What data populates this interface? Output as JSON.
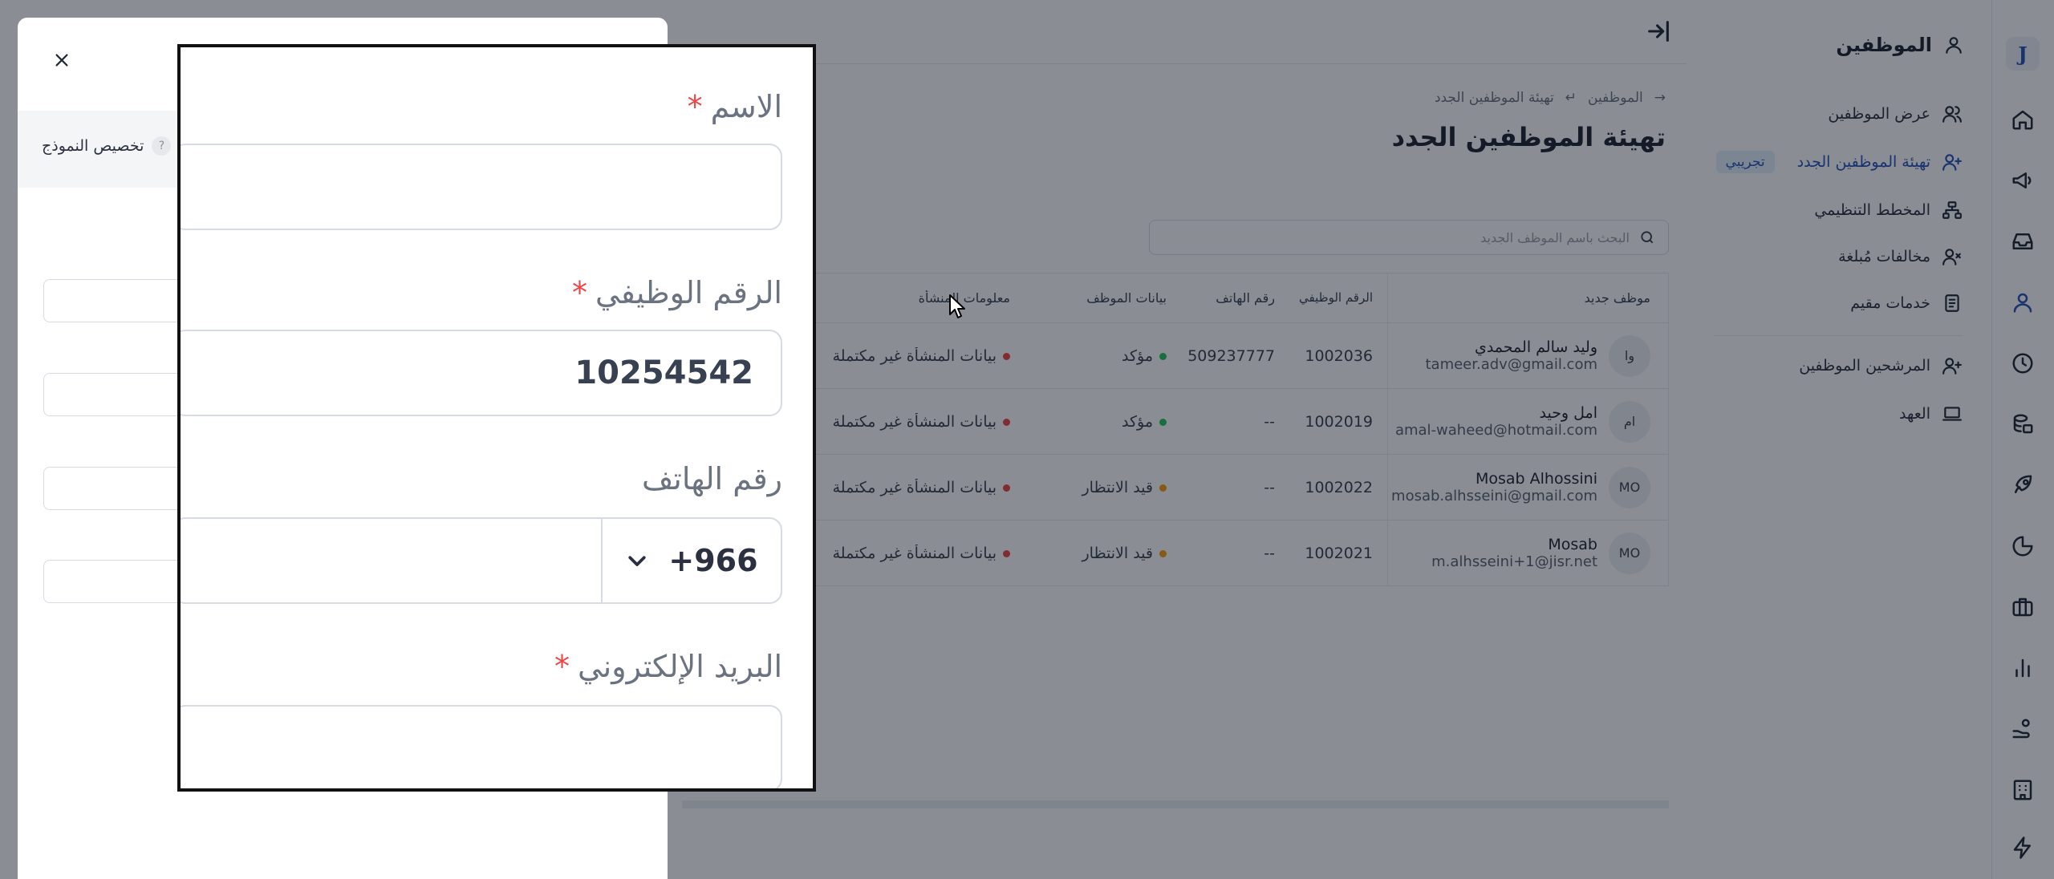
{
  "nav": {
    "section_title": "الموظفين",
    "items": [
      {
        "label": "عرض الموظفين"
      },
      {
        "label": "تهيئة الموظفين الجدد",
        "badge": "تجريبي",
        "active": true
      },
      {
        "label": "المخطط التنظيمي"
      },
      {
        "label": "مخالفات مُبلغة"
      },
      {
        "label": "خدمات مقيم"
      },
      {
        "label": "المرشحين الموظفين"
      },
      {
        "label": "العهد"
      }
    ]
  },
  "breadcrumb": {
    "root": "الموظفين",
    "current": "تهيئة الموظفين الجدد"
  },
  "page": {
    "title": "تهيئة الموظفين الجدد",
    "search_placeholder": "البحث باسم الموظف الجديد"
  },
  "table": {
    "headers": {
      "employee": "موظف جديد",
      "emp_no": "الرقم الوظيفي",
      "phone": "رقم الهاتف",
      "emp_data": "بيانات الموظف",
      "org_info": "معلومات المنشأة"
    },
    "rows": [
      {
        "initials": "وا",
        "name": "وليد سالم المحمدي",
        "email": "tameer.adv@gmail.com",
        "emp_no": "1002036",
        "phone": "509237777",
        "status": "مؤكد",
        "org": "بيانات المنشأة غير مكتملة"
      },
      {
        "initials": "ام",
        "name": "امل وحيد",
        "email": "amal-waheed@hotmail.com",
        "emp_no": "1002019",
        "phone": "--",
        "status": "مؤكد",
        "org": "بيانات المنشأة غير مكتملة"
      },
      {
        "initials": "MO",
        "name": "Mosab Alhossini",
        "email": "mosab.alhsseini@gmail.com",
        "emp_no": "1002022",
        "phone": "--",
        "status": "قيد الانتظار",
        "org": "بيانات المنشأة غير مكتملة"
      },
      {
        "initials": "MO",
        "name": "Mosab",
        "email": "m.alhsseini+1@jisr.net",
        "emp_no": "1002021",
        "phone": "--",
        "status": "قيد الانتظار",
        "org": "بيانات المنشأة غير مكتملة"
      }
    ]
  },
  "drawer": {
    "customize_label": "تخصيص النموذج",
    "help_mark": "?"
  },
  "form": {
    "name_label": "الاسم",
    "emp_no_label": "الرقم الوظيفي",
    "emp_no_value": "10254542",
    "phone_label": "رقم الهاتف",
    "country_code": "+966",
    "email_label": "البريد الإلكتروني",
    "required_mark": "*"
  },
  "colors": {
    "accent": "#2553b8",
    "status_confirmed": "#22c55e",
    "status_pending": "#f59e0b",
    "status_incomplete": "#ef4444",
    "required": "#ef4444"
  },
  "icons": {
    "logo_letter": "J"
  }
}
